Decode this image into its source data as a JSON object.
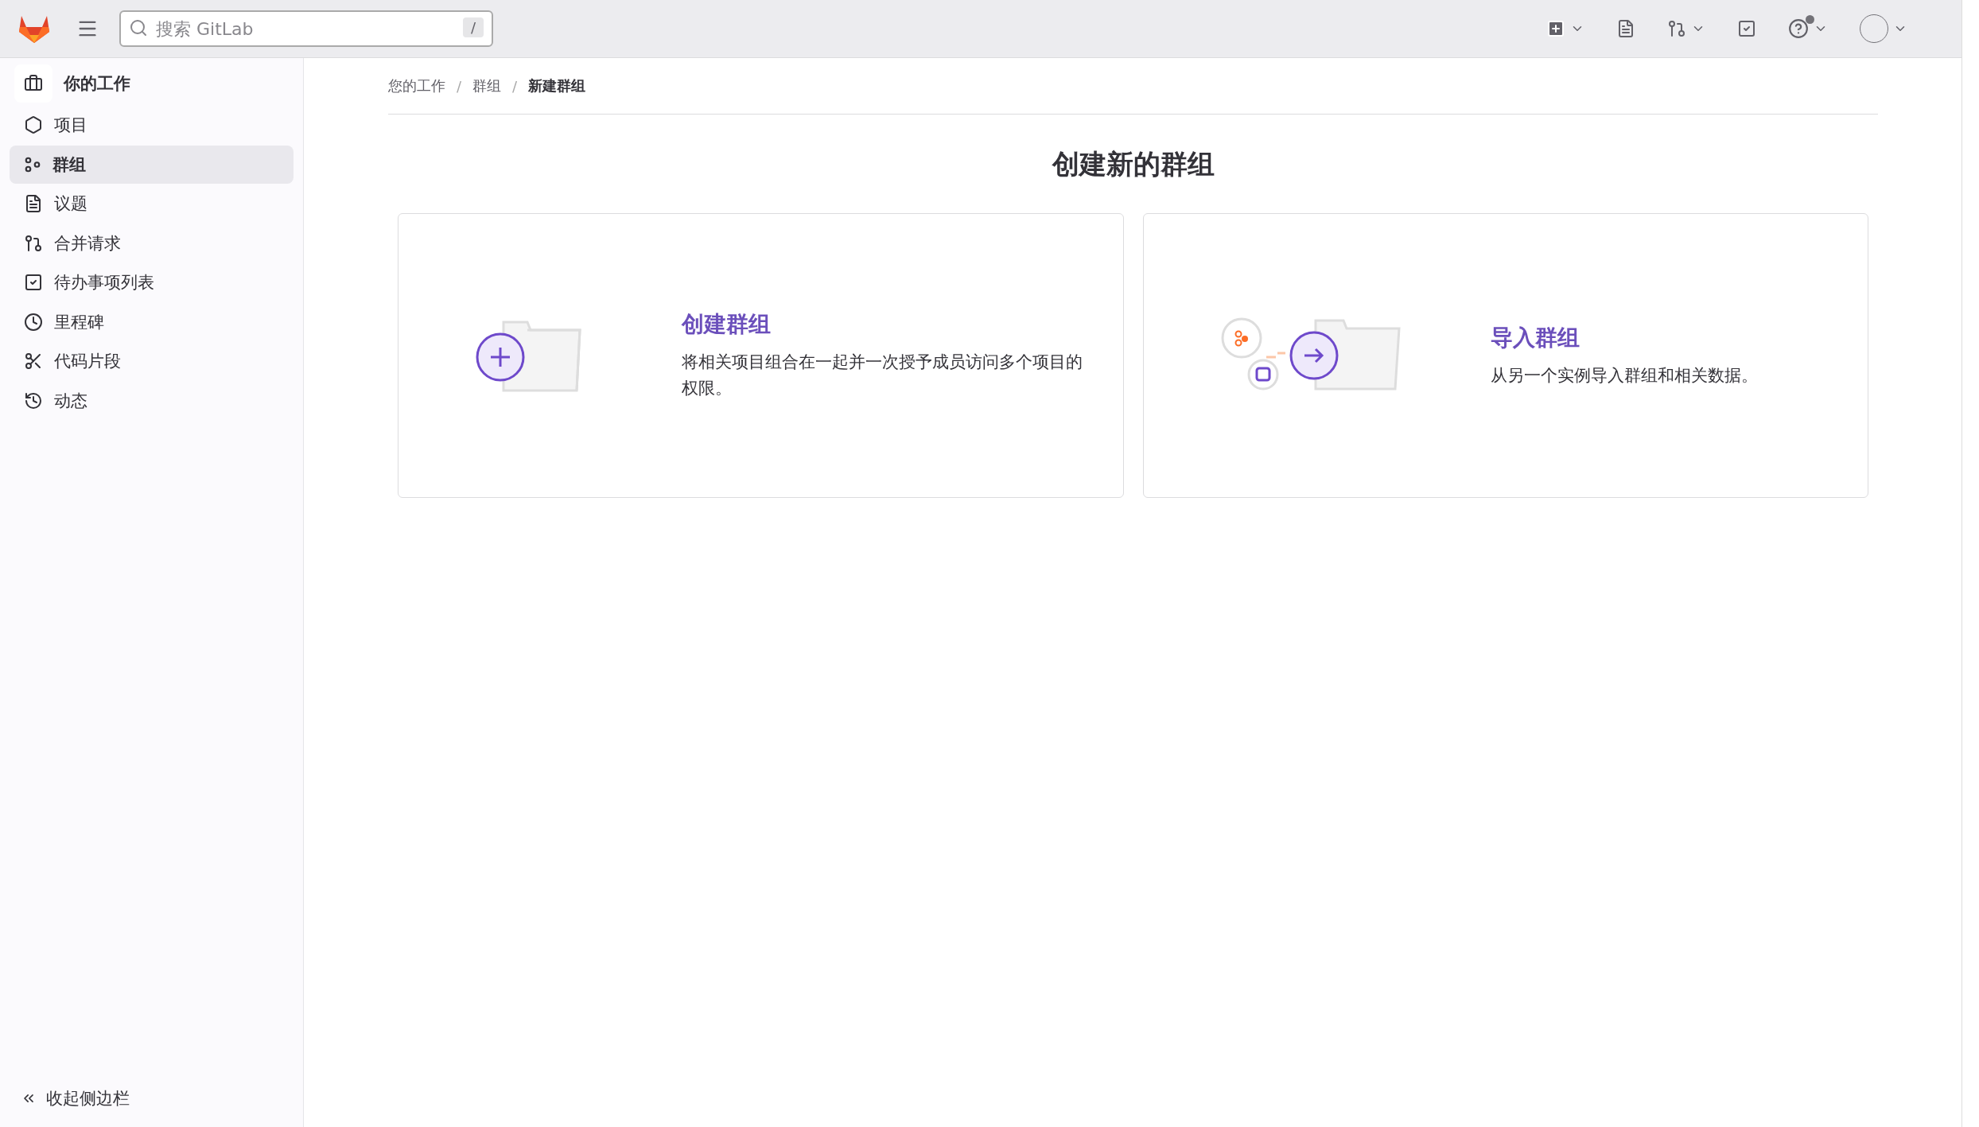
{
  "top_bar": {
    "search": {
      "placeholder": "搜索 GitLab",
      "shortcut": "/"
    },
    "help_notification": true
  },
  "sidebar": {
    "context": "你的工作",
    "items": [
      {
        "label": "项目",
        "selected": false
      },
      {
        "label": "群组",
        "selected": true
      },
      {
        "label": "议题",
        "selected": false
      },
      {
        "label": "合并请求",
        "selected": false
      },
      {
        "label": "待办事项列表",
        "selected": false
      },
      {
        "label": "里程碑",
        "selected": false
      },
      {
        "label": "代码片段",
        "selected": false
      },
      {
        "label": "动态",
        "selected": false
      }
    ],
    "collapse": "收起侧边栏"
  },
  "breadcrumbs": [
    "您的工作",
    "群组",
    "新建群组"
  ],
  "breadcrumb_separators": [
    "/",
    "/"
  ],
  "title": "创建新的群组",
  "cards": [
    {
      "kind": "create",
      "title": "创建群组",
      "description": "将相关项目组合在一起并一次授予成员访问多个项目的权限。"
    },
    {
      "kind": "import",
      "title": "导入群组",
      "description": "从另一个实例导入群组和相关数据。"
    }
  ]
}
